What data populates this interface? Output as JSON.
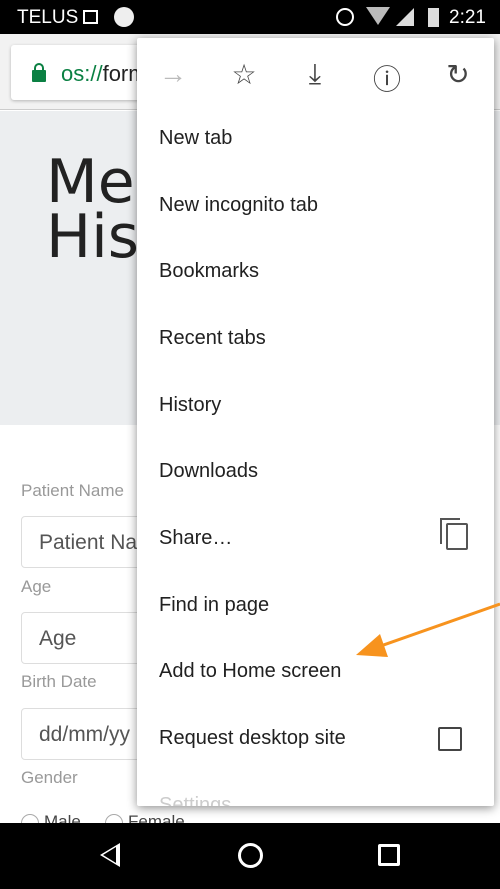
{
  "status_bar": {
    "carrier": "TELUS",
    "time": "2:21"
  },
  "browser": {
    "url_scheme": "os://",
    "url_rest": "form"
  },
  "page": {
    "title_line1": "Med",
    "title_line2": "Hist",
    "fields": [
      {
        "label": "Patient Name",
        "placeholder": "Patient Na"
      },
      {
        "label": "Age",
        "placeholder": "Age"
      },
      {
        "label": "Birth Date",
        "placeholder": "dd/mm/yy"
      }
    ],
    "gender_label": "Gender",
    "gender_options": [
      "Male",
      "Female"
    ]
  },
  "menu": {
    "top_icons": [
      "forward-icon",
      "bookmark-star-icon",
      "download-icon",
      "info-icon",
      "refresh-icon"
    ],
    "items": [
      "New tab",
      "New incognito tab",
      "Bookmarks",
      "Recent tabs",
      "History",
      "Downloads",
      "Share…",
      "Find in page",
      "Add to Home screen",
      "Request desktop site",
      "Settings"
    ]
  },
  "annotation": {
    "arrow_color": "#f7931e",
    "target": "Add to Home screen"
  }
}
